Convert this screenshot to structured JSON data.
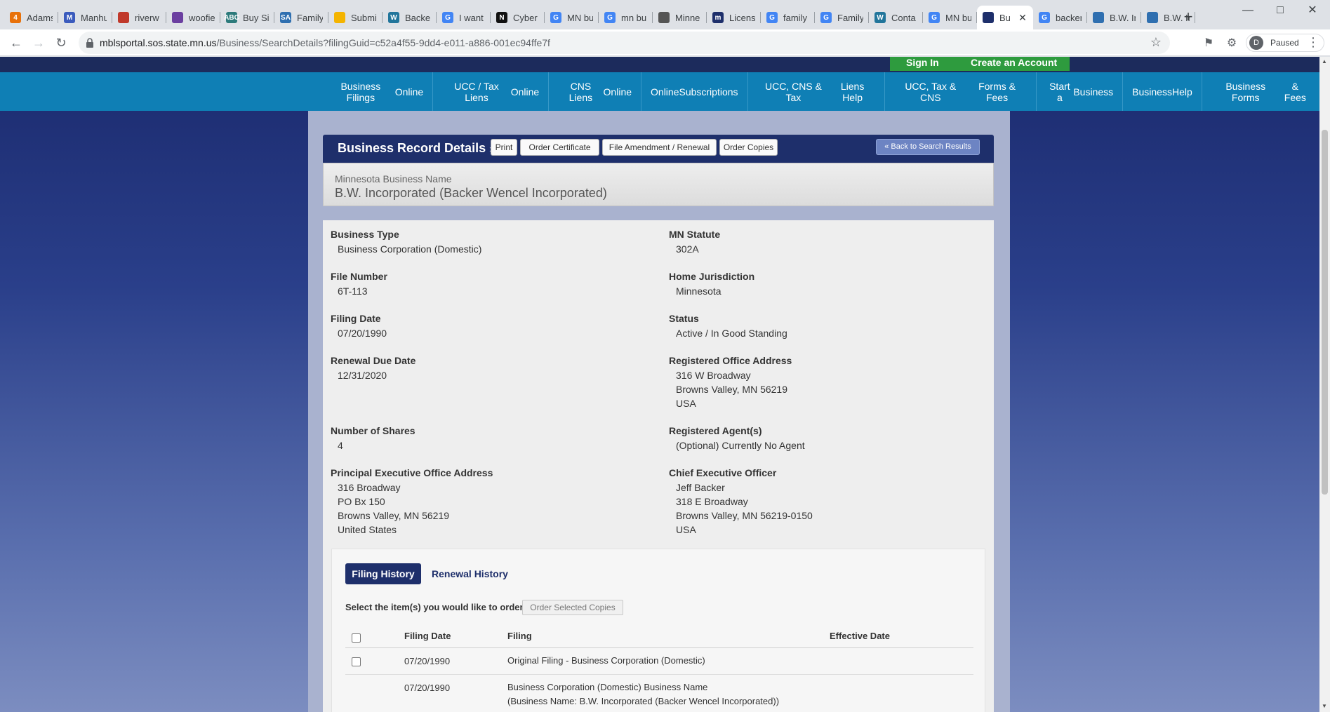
{
  "browser": {
    "tabs": [
      {
        "label": "Adams",
        "fav": "4",
        "color": "#e8710a"
      },
      {
        "label": "Manhu",
        "fav": "M",
        "color": "#3b5bbd"
      },
      {
        "label": "riverw",
        "fav": "",
        "color": "#c0392b"
      },
      {
        "label": "woofie",
        "fav": "",
        "color": "#6b3fa0"
      },
      {
        "label": "Buy Sil",
        "fav": "ABC",
        "color": "#2c7a7b"
      },
      {
        "label": "Family",
        "fav": "SA",
        "color": "#2f6fb0"
      },
      {
        "label": "Submi",
        "fav": "",
        "color": "#f4b400"
      },
      {
        "label": "Backer",
        "fav": "W",
        "color": "#21759b"
      },
      {
        "label": "I want",
        "fav": "G",
        "color": "#4285f4"
      },
      {
        "label": "Cyber",
        "fav": "N",
        "color": "#111111"
      },
      {
        "label": "MN bu",
        "fav": "G",
        "color": "#4285f4"
      },
      {
        "label": "mn bu",
        "fav": "G",
        "color": "#4285f4"
      },
      {
        "label": "Minne",
        "fav": "",
        "color": "#555555"
      },
      {
        "label": "Licens",
        "fav": "m",
        "color": "#1e2f6b"
      },
      {
        "label": "family",
        "fav": "G",
        "color": "#4285f4"
      },
      {
        "label": "Family",
        "fav": "G",
        "color": "#4285f4"
      },
      {
        "label": "Conta",
        "fav": "W",
        "color": "#21759b"
      },
      {
        "label": "MN bu",
        "fav": "G",
        "color": "#4285f4"
      },
      {
        "label": "Bu",
        "fav": "",
        "color": "#1e2f6b",
        "active": true
      },
      {
        "label": "backer",
        "fav": "G",
        "color": "#4285f4"
      },
      {
        "label": "B.W. Ir",
        "fav": "",
        "color": "#2f6fb0"
      },
      {
        "label": "B.W. Ir",
        "fav": "",
        "color": "#2f6fb0"
      }
    ],
    "url_host": "mblsportal.sos.state.mn.us",
    "url_path": "/Business/SearchDetails?filingGuid=c52a4f55-9dd4-e011-a886-001ec94ffe7f",
    "profile_initial": "D",
    "profile_status": "Paused"
  },
  "site": {
    "sign_in": "Sign In",
    "create_account": "Create an Account",
    "nav": [
      {
        "line1": "Business Filings",
        "line2": "Online"
      },
      {
        "line1": "UCC / Tax Liens",
        "line2": "Online"
      },
      {
        "line1": "CNS Liens",
        "line2": "Online"
      },
      {
        "line1": "Online",
        "line2": "Subscriptions"
      },
      {
        "line1": "UCC, CNS & Tax",
        "line2": "Liens Help"
      },
      {
        "line1": "UCC, Tax & CNS",
        "line2": "Forms & Fees"
      },
      {
        "line1": "Start a",
        "line2": "Business"
      },
      {
        "line1": "Business",
        "line2": "Help"
      },
      {
        "line1": "Business Forms",
        "line2": "& Fees"
      }
    ]
  },
  "record": {
    "title": "Business Record Details",
    "title_suffix": "»",
    "buttons": {
      "print": "Print",
      "order_certificate": "Order Certificate",
      "file_amendment": "File Amendment / Renewal",
      "order_copies": "Order Copies",
      "back": "« Back to Search Results"
    },
    "name_label": "Minnesota Business Name",
    "name_value": "B.W. Incorporated (Backer Wencel Incorporated)",
    "left": [
      {
        "label": "Business Type",
        "lines": [
          "Business Corporation (Domestic)"
        ]
      },
      {
        "label": "File Number",
        "lines": [
          "6T-113"
        ]
      },
      {
        "label": "Filing Date",
        "lines": [
          "07/20/1990"
        ]
      },
      {
        "label": "Renewal Due Date",
        "lines": [
          "12/31/2020"
        ]
      },
      {
        "label": "Number of Shares",
        "lines": [
          "4"
        ]
      },
      {
        "label": "Principal Executive Office Address",
        "lines": [
          "316 Broadway",
          "PO Bx 150",
          "Browns Valley, MN 56219",
          "United States"
        ]
      }
    ],
    "right": [
      {
        "label": "MN Statute",
        "lines": [
          "302A"
        ]
      },
      {
        "label": "Home Jurisdiction",
        "lines": [
          "Minnesota"
        ]
      },
      {
        "label": "Status",
        "lines": [
          "Active / In Good Standing"
        ]
      },
      {
        "label": "Registered Office Address",
        "lines": [
          "316 W Broadway",
          "Browns Valley, MN 56219",
          "USA"
        ]
      },
      {
        "label": "Registered Agent(s)",
        "lines": [
          "(Optional) Currently No Agent"
        ]
      },
      {
        "label": "Chief Executive Officer",
        "lines": [
          "Jeff Backer",
          "318 E Broadway",
          "Browns Valley, MN 56219-0150",
          "USA"
        ]
      }
    ]
  },
  "history": {
    "tab_filing": "Filing History",
    "tab_renewal": "Renewal History",
    "select_prompt": "Select the item(s) you would like to order:",
    "order_selected": "Order Selected Copies",
    "columns": {
      "filing_date": "Filing Date",
      "filing": "Filing",
      "effective_date": "Effective Date"
    },
    "rows": [
      {
        "filing_date": "07/20/1990",
        "filing": [
          "Original Filing - Business Corporation (Domestic)"
        ],
        "effective_date": "",
        "checkbox": true
      },
      {
        "filing_date": "07/20/1990",
        "filing": [
          "Business Corporation (Domestic) Business Name",
          "(Business Name: B.W. Incorporated (Backer Wencel Incorporated))"
        ],
        "effective_date": "",
        "checkbox": false
      }
    ]
  }
}
